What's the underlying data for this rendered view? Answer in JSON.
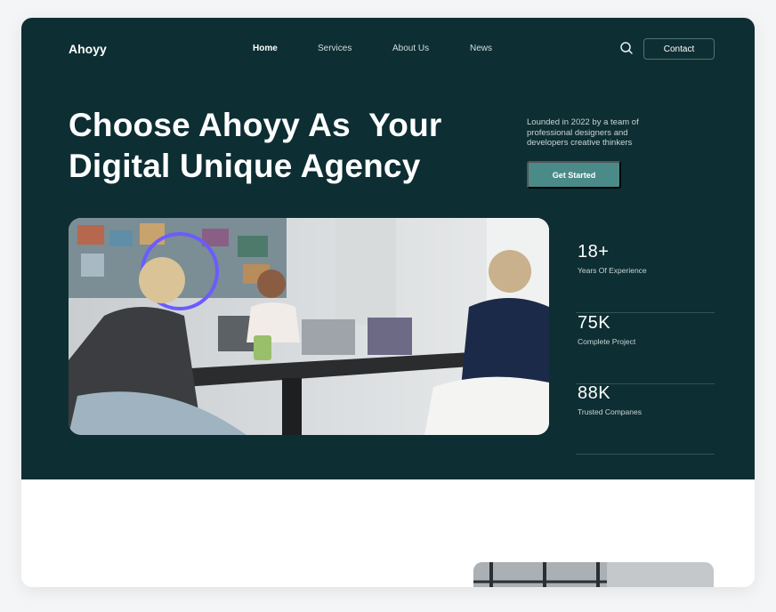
{
  "brand": {
    "name": "Ahoyy",
    "colors": {
      "dark": "#0d2e32",
      "accent": "#4a8a89",
      "white": "#ffffff"
    }
  },
  "nav": {
    "items": [
      {
        "label": "Home",
        "active": true
      },
      {
        "label": "Services",
        "active": false
      },
      {
        "label": "About Us",
        "active": false
      },
      {
        "label": "News",
        "active": false
      }
    ],
    "search_icon": "search-icon",
    "contact_label": "Contact"
  },
  "hero": {
    "headline_line1": "Choose Ahoyy As  Your",
    "headline_line2": "Digital Unique Agency",
    "tagline": "Lounded in 2022 by a team of professional designers and developers creative thinkers",
    "cta_label": "Get Started",
    "photo_description": "team-meeting-photo"
  },
  "stats": [
    {
      "value": "18+",
      "label": "Years Of Experience"
    },
    {
      "value": "75K",
      "label": "Complete Project"
    },
    {
      "value": "88K",
      "label": "Trusted Companes"
    }
  ]
}
